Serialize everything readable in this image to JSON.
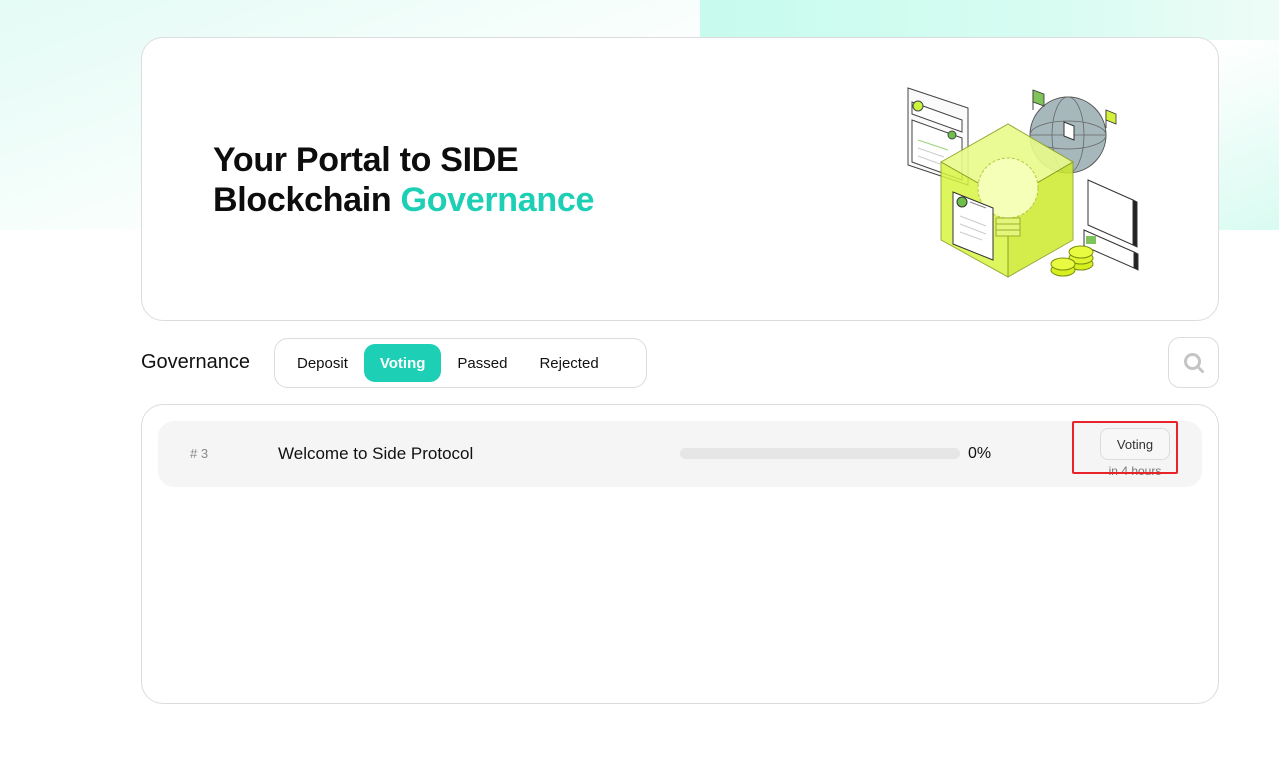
{
  "hero": {
    "title_line1": "Your Portal to SIDE",
    "title_line2": "Blockchain",
    "title_accent": "Governance",
    "accent_color": "#1ccfb5"
  },
  "governance": {
    "label": "Governance",
    "tabs": [
      {
        "label": "Deposit",
        "active": false
      },
      {
        "label": "Voting",
        "active": true
      },
      {
        "label": "Passed",
        "active": false
      },
      {
        "label": "Rejected",
        "active": false
      }
    ],
    "search_icon": "search-icon"
  },
  "proposals": [
    {
      "id": "# 3",
      "title": "Welcome to Side Protocol",
      "progress_percent": 0,
      "progress_label": "0%",
      "status": "Voting",
      "time": "in 4 hours"
    }
  ]
}
